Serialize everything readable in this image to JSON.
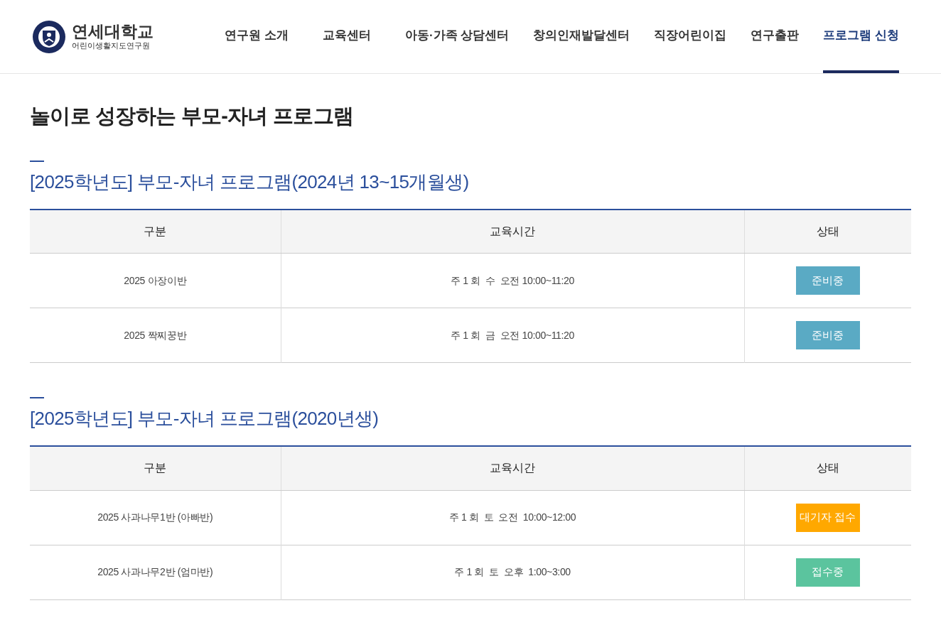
{
  "logo": {
    "title": "연세대학교",
    "subtitle": "어린이생활지도연구원"
  },
  "nav": [
    {
      "label": "연구원 소개",
      "selected": false
    },
    {
      "label": "교육센터",
      "selected": false
    },
    {
      "label": "아동·가족 상담센터",
      "selected": false
    },
    {
      "label": "창의인재발달센터",
      "selected": false
    },
    {
      "label": "직장어린이집",
      "selected": false
    },
    {
      "label": "연구출판",
      "selected": false
    },
    {
      "label": "프로그램 신청",
      "selected": true
    }
  ],
  "page_title": "놀이로 성장하는 부모-자녀 프로그램",
  "sections": [
    {
      "title": "[2025학년도] 부모-자녀 프로그램(2024년 13~15개월생)",
      "columns": [
        "구분",
        "교육시간",
        "상태"
      ],
      "rows": [
        {
          "name": "2025 아장이반",
          "time": "주 1 회  수  오전 10:00~11:20",
          "status": "준비중",
          "color": "#5aaac4"
        },
        {
          "name": "2025 짝찌꿍반",
          "time": "주 1 회  금  오전 10:00~11:20",
          "status": "준비중",
          "color": "#5aaac4"
        }
      ]
    },
    {
      "title": "[2025학년도] 부모-자녀 프로그램(2020년생)",
      "columns": [
        "구분",
        "교육시간",
        "상태"
      ],
      "rows": [
        {
          "name": "2025 사과나무1반 (아빠반)",
          "time": "주 1 회  토  오전  10:00~12:00",
          "status": "대기자 접수",
          "color": "#ffa800"
        },
        {
          "name": "2025 사과나무2반 (엄마반)",
          "time": "주 1 회  토  오후  1:00~3:00",
          "status": "접수중",
          "color": "#5bc49e"
        }
      ]
    }
  ]
}
